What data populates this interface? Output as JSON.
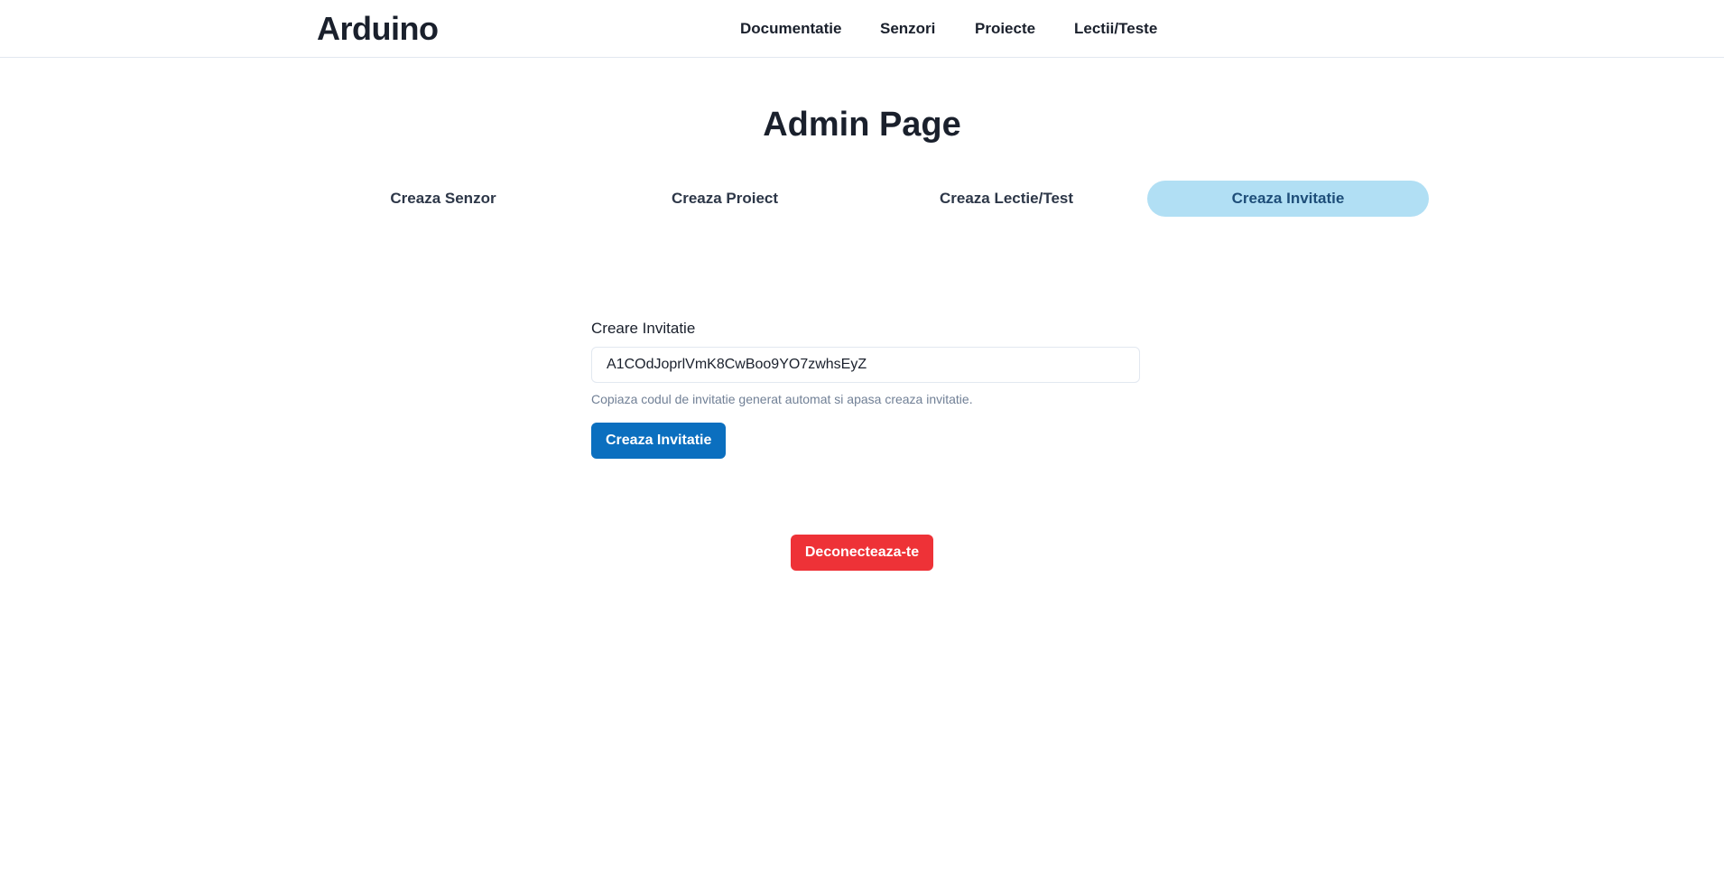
{
  "header": {
    "brand": "Arduino",
    "nav": [
      {
        "label": "Documentatie"
      },
      {
        "label": "Senzori"
      },
      {
        "label": "Proiecte"
      },
      {
        "label": "Lectii/Teste"
      }
    ]
  },
  "main": {
    "title": "Admin Page",
    "tabs": [
      {
        "label": "Creaza Senzor",
        "active": false
      },
      {
        "label": "Creaza Proiect",
        "active": false
      },
      {
        "label": "Creaza Lectie/Test",
        "active": false
      },
      {
        "label": "Creaza Invitatie",
        "active": true
      }
    ],
    "form": {
      "label": "Creare Invitatie",
      "input_value": "A1COdJoprlVmK8CwBoo9YO7zwhsEyZ",
      "help_text": "Copiaza codul de invitatie generat automat si apasa creaza invitatie.",
      "submit_label": "Creaza Invitatie"
    },
    "logout_label": "Deconecteaza-te"
  },
  "colors": {
    "active_tab_bg": "#b1dff4",
    "primary_button": "#0b6fbf",
    "danger_button": "#ee3237"
  }
}
